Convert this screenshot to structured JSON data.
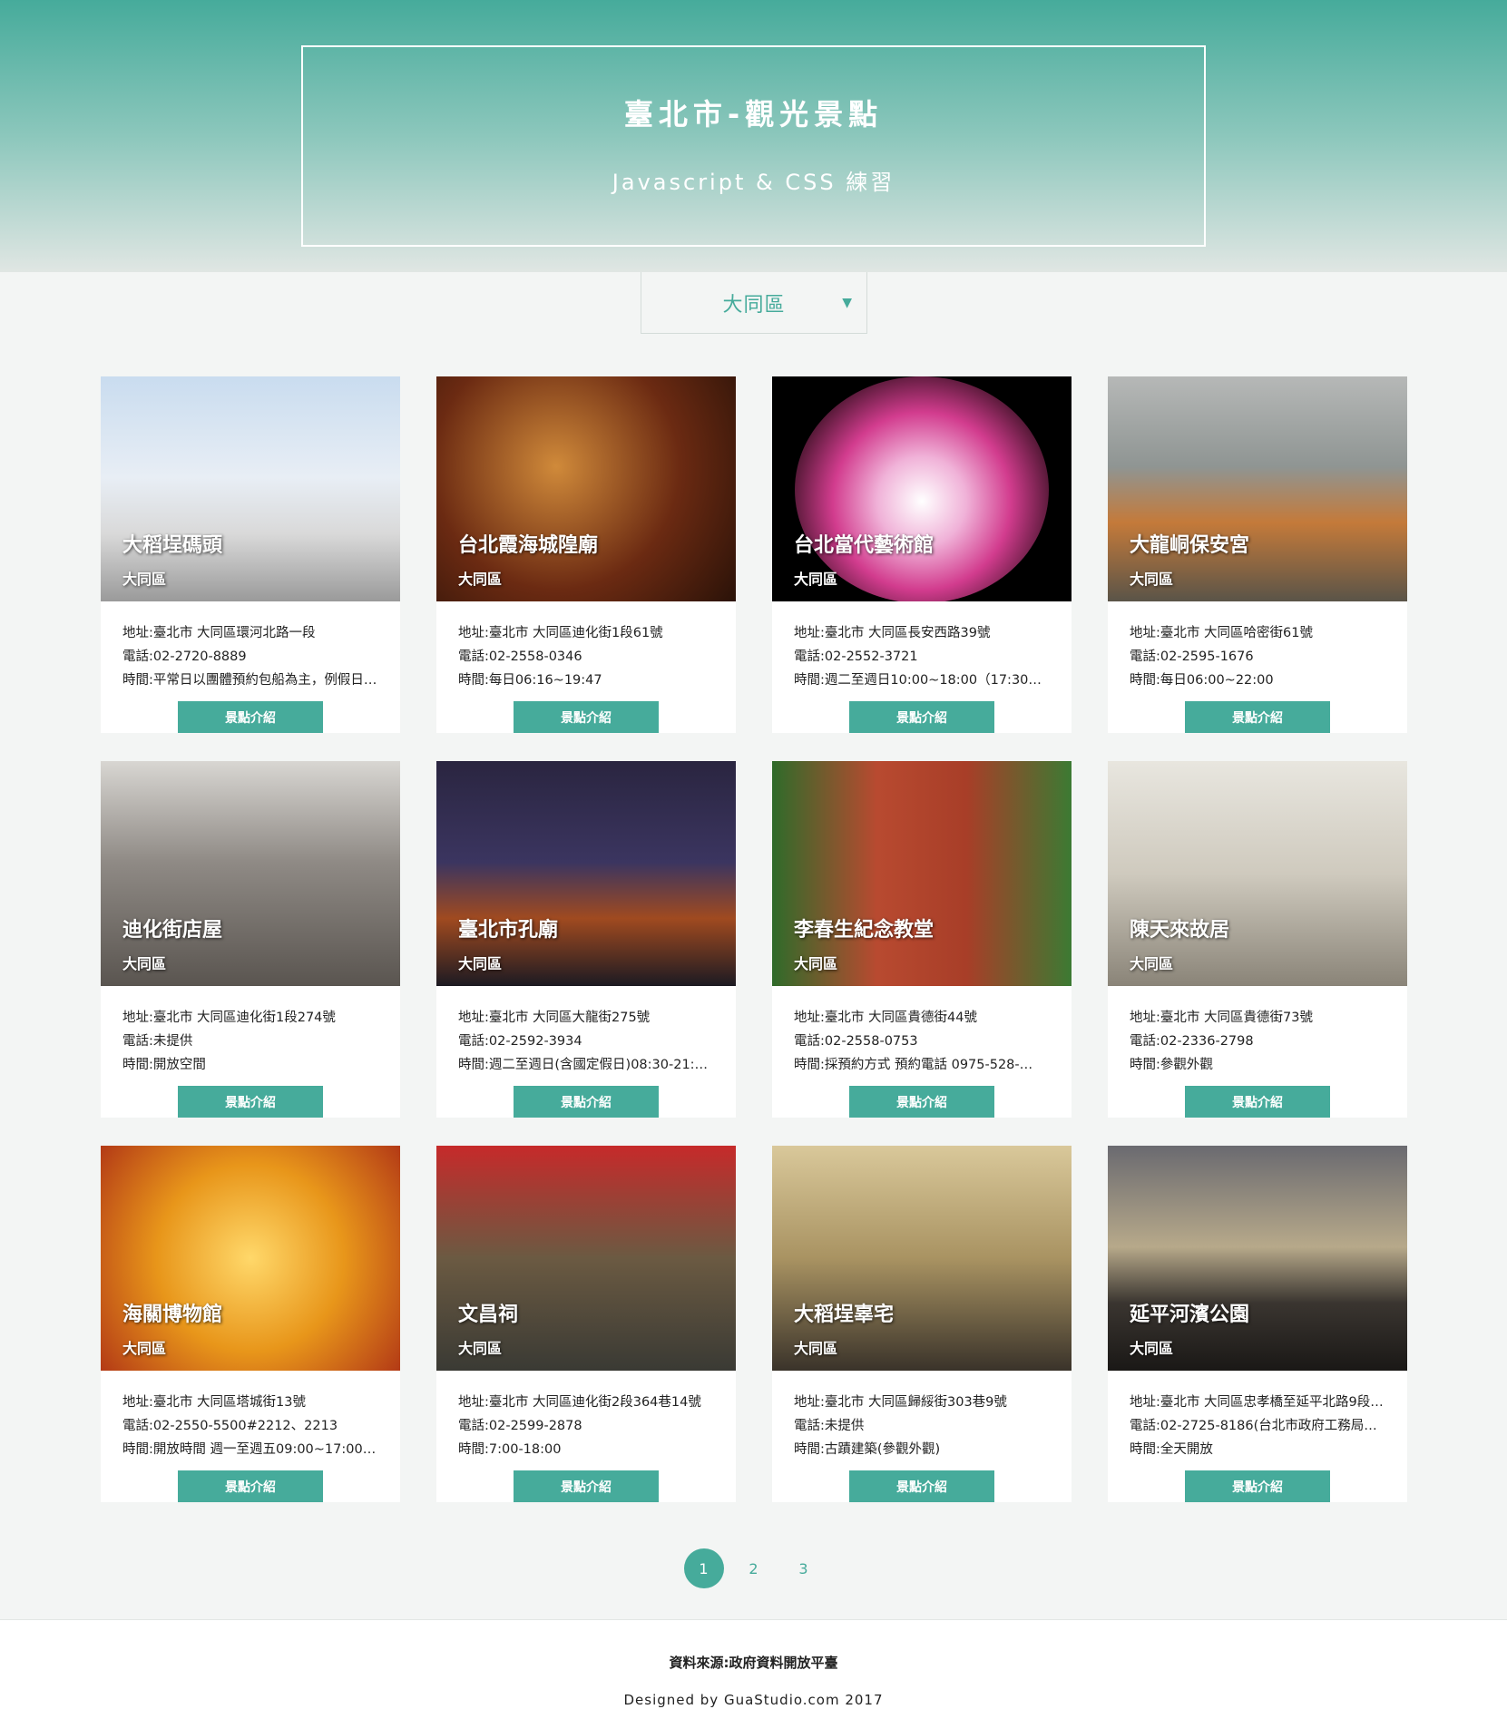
{
  "header": {
    "title": "臺北市-觀光景點",
    "subtitle": "Javascript & CSS 練習"
  },
  "district_select": {
    "value": "大同區",
    "arrow": "▼"
  },
  "colors": {
    "accent": "#46ab9b",
    "background": "#f3f5f4"
  },
  "cards": [
    {
      "name": "大稻埕碼頭",
      "district": "大同區",
      "address": "地址:臺北市 大同區環河北路一段",
      "phone": "電話:02-2720-8889",
      "time": "時間:平常日以團體預約包船為主，例假日…",
      "button": "景點介紹"
    },
    {
      "name": "台北霞海城隍廟",
      "district": "大同區",
      "address": "地址:臺北市 大同區迪化街1段61號",
      "phone": "電話:02-2558-0346",
      "time": "時間:每日06:16~19:47",
      "button": "景點介紹"
    },
    {
      "name": "台北當代藝術館",
      "district": "大同區",
      "address": "地址:臺北市 大同區長安西路39號",
      "phone": "電話:02-2552-3721",
      "time": "時間:週二至週日10:00~18:00（17:30停…",
      "button": "景點介紹"
    },
    {
      "name": "大龍峒保安宮",
      "district": "大同區",
      "address": "地址:臺北市 大同區哈密街61號",
      "phone": "電話:02-2595-1676",
      "time": "時間:每日06:00~22:00",
      "button": "景點介紹"
    },
    {
      "name": "迪化街店屋",
      "district": "大同區",
      "address": "地址:臺北市 大同區迪化街1段274號",
      "phone": "電話:未提供",
      "time": "時間:開放空間",
      "button": "景點介紹"
    },
    {
      "name": "臺北市孔廟",
      "district": "大同區",
      "address": "地址:臺北市 大同區大龍街275號",
      "phone": "電話:02-2592-3934",
      "time": "時間:週二至週日(含國定假日)08:30-21:…",
      "button": "景點介紹"
    },
    {
      "name": "李春生紀念教堂",
      "district": "大同區",
      "address": "地址:臺北市 大同區貴德街44號",
      "phone": "電話:02-2558-0753",
      "time": "時間:採預約方式 預約電話 0975-528-…",
      "button": "景點介紹"
    },
    {
      "name": "陳天來故居",
      "district": "大同區",
      "address": "地址:臺北市 大同區貴德街73號",
      "phone": "電話:02-2336-2798",
      "time": "時間:參觀外觀",
      "button": "景點介紹"
    },
    {
      "name": "海關博物館",
      "district": "大同區",
      "address": "地址:臺北市 大同區塔城街13號",
      "phone": "電話:02-2550-5500#2212、2213",
      "time": "時間:開放時間 週一至週五09:00~17:00…",
      "button": "景點介紹"
    },
    {
      "name": "文昌祠",
      "district": "大同區",
      "address": "地址:臺北市 大同區迪化街2段364巷14號",
      "phone": "電話:02-2599-2878",
      "time": "時間:7:00-18:00",
      "button": "景點介紹"
    },
    {
      "name": "大稻埕辜宅",
      "district": "大同區",
      "address": "地址:臺北市 大同區歸綏街303巷9號",
      "phone": "電話:未提供",
      "time": "時間:古蹟建築(參觀外觀)",
      "button": "景點介紹"
    },
    {
      "name": "延平河濱公園",
      "district": "大同區",
      "address": "地址:臺北市 大同區忠孝橋至延平北路9段…",
      "phone": "電話:02-2725-8186(台北市政府工務局…",
      "time": "時間:全天開放",
      "button": "景點介紹"
    }
  ],
  "pagination": {
    "pages": [
      "1",
      "2",
      "3"
    ],
    "active": "1"
  },
  "footer": {
    "source": "資料來源:政府資料開放平臺",
    "credit": "Designed by GuaStudio.com 2017"
  }
}
